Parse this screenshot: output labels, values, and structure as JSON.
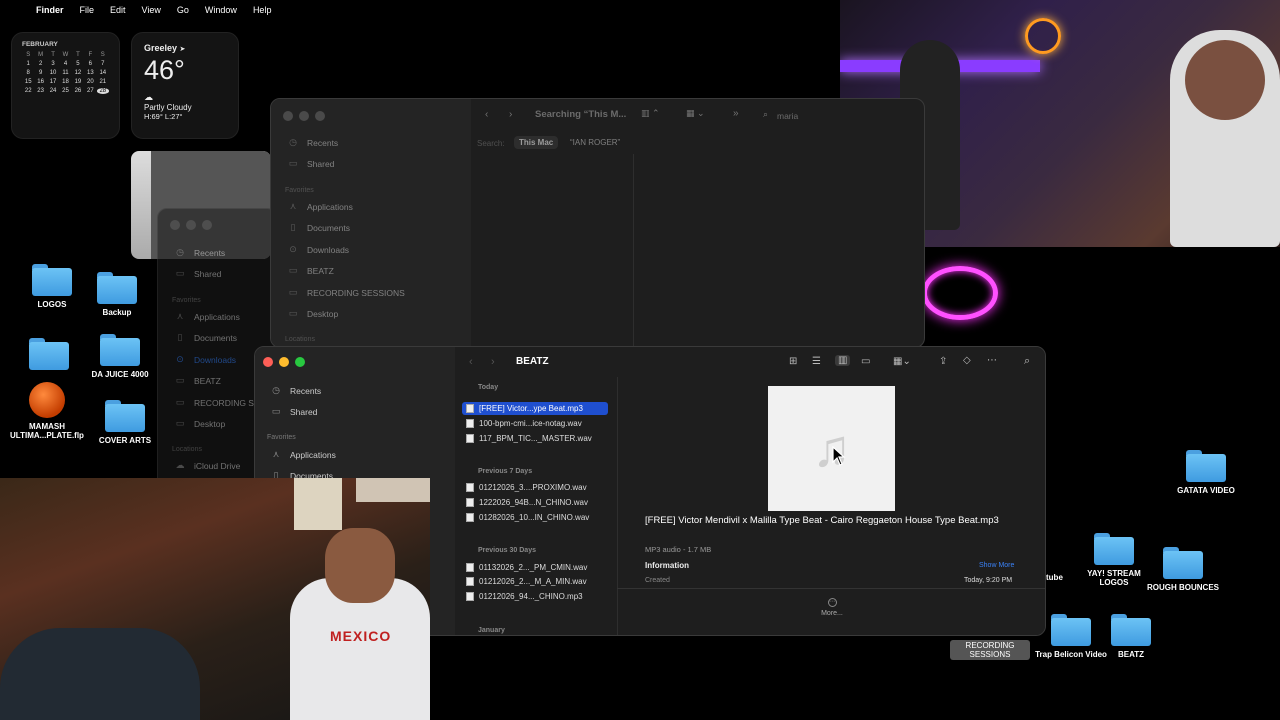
{
  "menubar": {
    "apple": "",
    "app": "Finder",
    "items": [
      "File",
      "Edit",
      "View",
      "Go",
      "Window",
      "Help"
    ]
  },
  "calendar": {
    "month": "FEBRUARY",
    "days_header": [
      "S",
      "M",
      "T",
      "W",
      "T",
      "F",
      "S"
    ],
    "dates": [
      "1",
      "2",
      "3",
      "4",
      "5",
      "6",
      "7",
      "8",
      "9",
      "10",
      "11",
      "12",
      "13",
      "14",
      "15",
      "16",
      "17",
      "18",
      "19",
      "20",
      "21",
      "22",
      "23",
      "24",
      "25",
      "26",
      "27",
      "28"
    ],
    "today": "28"
  },
  "weather": {
    "city": "Greeley",
    "temp": "46°",
    "condition": "Partly Cloudy",
    "high_low": "H:69° L:27°"
  },
  "desktop_icons": {
    "logos": "LOGOS",
    "backup": "Backup",
    "da_juice": "DA JUICE 4000",
    "mamash": "MAMASH ULTIMA...PLATE.flp",
    "cover_arts": "COVER ARTS",
    "gatata": "GATATA VIDEO",
    "yay_stream": "YAY! STREAM LOGOS",
    "rough": "ROUGH BOUNCES",
    "tube": "tube",
    "recording": "RECORDING SESSIONS",
    "trap": "Trap Belicon Video",
    "beatz": "BEATZ"
  },
  "back_window": {
    "title": "Searching “This M...",
    "search_value": "maria",
    "search_label": "Search:",
    "scope_this_mac": "This Mac",
    "scope_folder": "“IAN ROGER”",
    "sidebar": {
      "recents": "Recents",
      "shared": "Shared",
      "favorites": "Favorites",
      "applications": "Applications",
      "documents": "Documents",
      "downloads": "Downloads",
      "beatz": "BEATZ",
      "recording": "RECORDING SESSIONS",
      "desktop": "Desktop",
      "locations": "Locations"
    }
  },
  "back_window2": {
    "recents": "Recents",
    "shared": "Shared",
    "favorites": "Favorites",
    "applications": "Applications",
    "documents": "Documents",
    "downloads": "Downloads",
    "beatz": "BEATZ",
    "recording": "RECORDING S",
    "desktop": "Desktop",
    "locations": "Locations",
    "icloud": "iCloud Drive"
  },
  "front_window": {
    "title": "BEATZ",
    "sidebar": {
      "recents": "Recents",
      "shared": "Shared",
      "favorites": "Favorites",
      "applications": "Applications",
      "documents": "Documents"
    },
    "groups": {
      "today": "Today",
      "prev7": "Previous 7 Days",
      "prev30": "Previous 30 Days",
      "january": "January"
    },
    "files_today": [
      "[FREE] Victor...ype Beat.mp3",
      "100-bpm-cmi...ice-notag.wav",
      "117_BPM_TIC..._MASTER.wav"
    ],
    "files_prev7": [
      "01212026_3....PROXIMO.wav",
      "1222026_94B...N_CHINO.wav",
      "01282026_10...IN_CHINO.wav"
    ],
    "files_prev30": [
      "01132026_2..._PM_CMIN.wav",
      "01212026_2..._M_A_MIN.wav",
      "01212026_94..._CHINO.mp3"
    ],
    "preview": {
      "title": "[FREE] Victor Mendivil x Malilla Type Beat - Cairo  Reggaeton House Type Beat.mp3",
      "subtitle": "MP3 audio - 1.7 MB",
      "info_heading": "Information",
      "show_more": "Show More",
      "created_label": "Created",
      "created_value": "Today, 9:20 PM",
      "more": "More..."
    }
  },
  "camera": {
    "shirt_text": "MEXICO"
  }
}
